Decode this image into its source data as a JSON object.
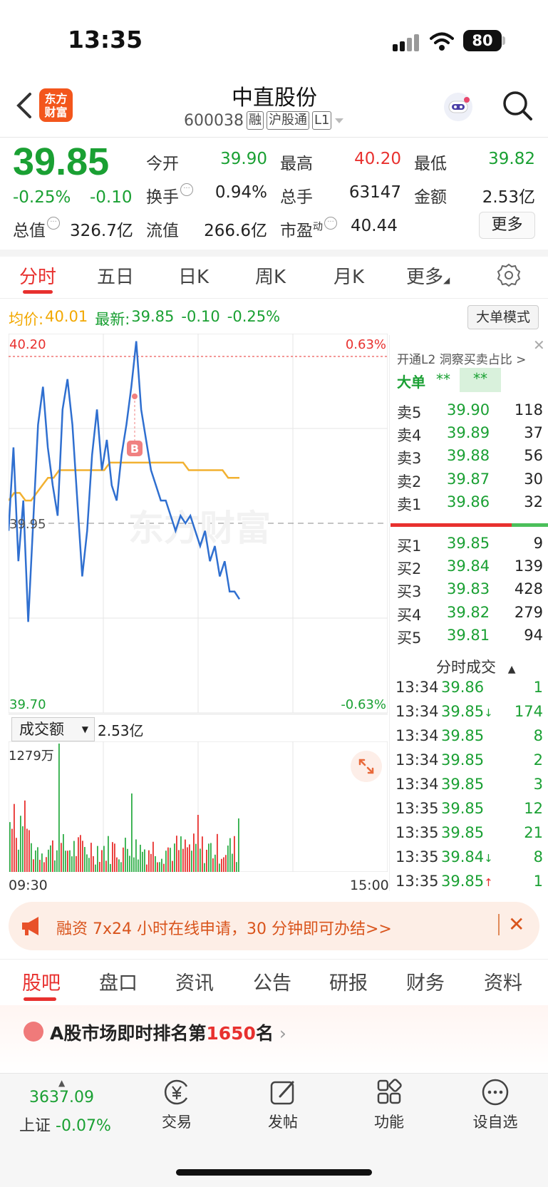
{
  "status": {
    "time": "13:35",
    "battery": "80"
  },
  "header": {
    "logo_line1": "东方",
    "logo_line2": "财富",
    "name": "中直股份",
    "code": "600038",
    "tags": [
      "融",
      "沪股通",
      "L1"
    ]
  },
  "quote": {
    "price": "39.85",
    "pct": "-0.25%",
    "change": "-0.10",
    "open_label": "今开",
    "open": "39.90",
    "high_label": "最高",
    "high": "40.20",
    "low_label": "最低",
    "low": "39.82",
    "turnover_label": "换手",
    "turnover": "0.94%",
    "volume_label": "总手",
    "volume": "63147",
    "amount_label": "金额",
    "amount": "2.53亿",
    "mktcap_label": "总值",
    "mktcap": "326.7亿",
    "float_label": "流值",
    "float": "266.6亿",
    "pe_label": "市盈",
    "pe_sup": "动",
    "pe": "40.44",
    "more": "更多"
  },
  "period_tabs": [
    "分时",
    "五日",
    "日K",
    "周K",
    "月K",
    "更多"
  ],
  "avg_bar": {
    "avg_label": "均价:",
    "avg": "40.01",
    "latest_label": "最新:",
    "latest": "39.85",
    "change": "-0.10",
    "pct": "-0.25%",
    "mode_button": "大单模式"
  },
  "chart_labels": {
    "y_top": "40.20",
    "y_mid": "39.95",
    "y_bottom": "39.70",
    "pct_top": "0.63%",
    "pct_bottom": "-0.63%",
    "watermark": "东方财富",
    "marker": "B"
  },
  "chart_data": {
    "type": "line",
    "ylim": [
      39.7,
      40.2
    ],
    "series": [
      {
        "name": "最新",
        "color": "#2f6fd0",
        "values": [
          39.94,
          40.05,
          39.9,
          39.98,
          39.82,
          39.95,
          40.08,
          40.13,
          40.05,
          40.0,
          39.96,
          40.1,
          40.14,
          40.08,
          39.98,
          39.88,
          39.94,
          40.04,
          40.1,
          40.02,
          40.06,
          40.0,
          39.98,
          40.04,
          40.08,
          40.13,
          40.19,
          40.1,
          40.06,
          40.02,
          40.0,
          39.98,
          39.98,
          39.96,
          39.94,
          39.96,
          39.95,
          39.96,
          39.94,
          39.92,
          39.94,
          39.9,
          39.92,
          39.88,
          39.9,
          39.86,
          39.86,
          39.85
        ]
      },
      {
        "name": "均价",
        "color": "#f2b131",
        "values": [
          39.98,
          39.99,
          39.99,
          39.98,
          39.98,
          39.99,
          40.0,
          40.01,
          40.01,
          40.02,
          40.02,
          40.02,
          40.02,
          40.02,
          40.02,
          40.02,
          40.02,
          40.02,
          40.03,
          40.03,
          40.03,
          40.03,
          40.03,
          40.03,
          40.03,
          40.03,
          40.03,
          40.03,
          40.03,
          40.03,
          40.03,
          40.03,
          40.02,
          40.02,
          40.02,
          40.02,
          40.02,
          40.02,
          40.02,
          40.01,
          40.01,
          40.01
        ]
      }
    ]
  },
  "order_book": {
    "banner": "开通L2 洞察买卖占比 >",
    "big_label": "大单",
    "big_stars": "**",
    "big_box": "**",
    "asks": [
      {
        "label": "卖5",
        "price": "39.90",
        "vol": "118"
      },
      {
        "label": "卖4",
        "price": "39.89",
        "vol": "37"
      },
      {
        "label": "卖3",
        "price": "39.88",
        "vol": "56"
      },
      {
        "label": "卖2",
        "price": "39.87",
        "vol": "30"
      },
      {
        "label": "卖1",
        "price": "39.86",
        "vol": "32"
      }
    ],
    "bids": [
      {
        "label": "买1",
        "price": "39.85",
        "vol": "9"
      },
      {
        "label": "买2",
        "price": "39.84",
        "vol": "139"
      },
      {
        "label": "买3",
        "price": "39.83",
        "vol": "428"
      },
      {
        "label": "买4",
        "price": "39.82",
        "vol": "279"
      },
      {
        "label": "买5",
        "price": "39.81",
        "vol": "94"
      }
    ],
    "ticks_title": "分时成交",
    "ticks": [
      {
        "time": "13:34",
        "price": "39.86",
        "vol": "1"
      },
      {
        "time": "13:34",
        "price": "39.85↓",
        "vol": "174"
      },
      {
        "time": "13:34",
        "price": "39.85",
        "vol": "8"
      },
      {
        "time": "13:34",
        "price": "39.85",
        "vol": "2"
      },
      {
        "time": "13:34",
        "price": "39.85",
        "vol": "3"
      },
      {
        "time": "13:35",
        "price": "39.85",
        "vol": "12"
      },
      {
        "time": "13:35",
        "price": "39.85",
        "vol": "21"
      },
      {
        "time": "13:35",
        "price": "39.84↓",
        "vol": "8"
      },
      {
        "time": "13:35",
        "price": "39.85↑",
        "vol": "1"
      }
    ]
  },
  "volume": {
    "select_label": "成交额",
    "total": "2.53亿",
    "max": "1279万",
    "t_start": "09:30",
    "t_end": "15:00"
  },
  "banner": {
    "text": "融资 7x24 小时在线申请，30 分钟即可办结>>"
  },
  "bottom_tabs": [
    "股吧",
    "盘口",
    "资讯",
    "公告",
    "研报",
    "财务",
    "资料"
  ],
  "rank": {
    "prefix": "A股市场即时排名第",
    "num": "1650",
    "suffix": "名"
  },
  "nav": {
    "index_value": "3637.09",
    "index_name": "上证",
    "index_pct": "-0.07%",
    "items": [
      "交易",
      "发帖",
      "功能",
      "设自选"
    ]
  }
}
